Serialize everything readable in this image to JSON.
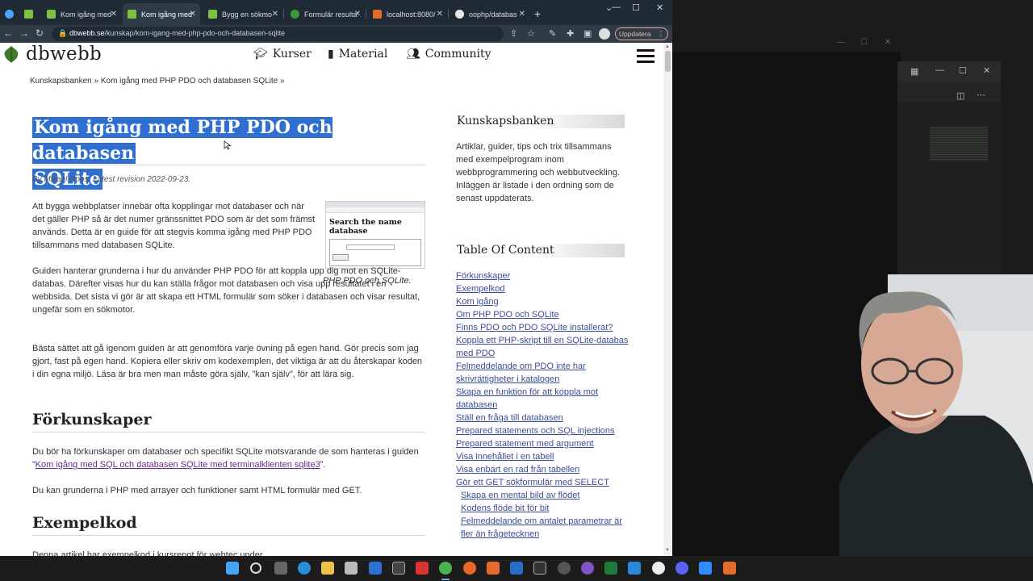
{
  "browser": {
    "tabs": [
      {
        "label": ""
      },
      {
        "label": ""
      },
      {
        "label": "Kom igång med"
      },
      {
        "label": "Kom igång med"
      },
      {
        "label": "Bygg en sökmo"
      },
      {
        "label": "Formulär resulta"
      },
      {
        "label": "localhost:8080/"
      },
      {
        "label": "oophp/databas"
      }
    ],
    "url_domain": "dbwebb.se",
    "url_path": "/kunskap/kom-igang-med-php-pdo-och-databasen-sqlite",
    "update_label": "Uppdatera"
  },
  "site": {
    "logo": "dbwebb",
    "nav": [
      {
        "label": "Kurser"
      },
      {
        "label": "Material"
      },
      {
        "label": "Community"
      }
    ],
    "breadcrumb": "Kunskapsbanken » Kom igång med PHP PDO och databasen SQLite »"
  },
  "article": {
    "title_line1": "Kom igång med PHP PDO och databasen",
    "title_line2": "SQLite",
    "byline": "By Mikael Roos. Latest revision 2022-09-23.",
    "p1": "Att bygga webbplatser innebär ofta kopplingar mot databaser och när det gäller PHP så är det numer gränssnittet PDO som är det som främst används. Detta är en guide för att stegvis komma igång med PHP PDO tillsammans med databasen SQLite.",
    "p2": "Guiden hanterar grunderna i hur du använder PHP PDO för att koppla upp dig mot en SQLite-databas. Därefter visas hur du kan ställa frågor mot databasen och visa upp resultatet i en webbsida. Det sista vi gör är att skapa ett HTML formulär som söker i databasen och visar resultat, ungefär som en sökmotor.",
    "p3": "Bästa sättet att gå igenom guiden är att genomföra varje övning på egen hand. Gör precis som jag gjort, fast på egen hand. Kopiera eller skriv om kodexemplen, det viktiga är att du återskapar koden i din egna miljö. Läsa är bra men man måste göra själv, ”kan själv”, för att lära sig.",
    "figure_heading": "Search the name database",
    "figure_caption": "PHP PDO och SQLite.",
    "h_prereq": "Förkunskaper",
    "prereq_p1_before": "Du bör ha förkunskaper om databaser och specifikt SQLite motsvarande de som hanteras i guiden ”",
    "prereq_link": "Kom igång med SQL och databasen SQLite med terminalklienten sqlite3",
    "prereq_p1_after": "”.",
    "prereq_p2": "Du kan grunderna i PHP med arrayer och funktioner samt HTML formulär med GET.",
    "h_example": "Exempelkod",
    "example_p": "Denna artikel har exempelkod i kursrepot för webtec under"
  },
  "sidebar": {
    "kb_heading": "Kunskapsbanken",
    "kb_text": "Artiklar, guider, tips och trix tillsammans med exempelprogram inom webbprogrammering och webbutveckling. Inläggen är listade i den ordning som de senast uppdaterats.",
    "toc_heading": "Table Of Content",
    "toc": [
      "Förkunskaper",
      "Exempelkod",
      "Kom igång",
      "Om PHP PDO och SQLite",
      "Finns PDO och PDO SQLite installerat?",
      "Koppla ett PHP-skript till en SQLite-databas med PDO",
      "Felmeddelande om PDO inte har skrivrättigheter i katalogen",
      "Skapa en funktion för att koppla mot databasen",
      "Ställ en fråga till databasen",
      "Prepared statements och SQL injections",
      "Prepared statement med argument",
      "Visa innehållet i en tabell",
      "Visa enbart en rad från tabellen",
      "Gör ett GET sökformulär med SELECT"
    ],
    "toc_sub": [
      "Skapa en mental bild av flödet",
      "Kodens flöde bit för bit",
      "Felmeddelande om antalet parametrar är fler än frågetecknen"
    ]
  },
  "colors": {
    "selection": "#2f6fd0",
    "toc_link": "#3a4d98",
    "visited_link": "#6b2a8a",
    "chrome_dark": "#1f2a35"
  }
}
